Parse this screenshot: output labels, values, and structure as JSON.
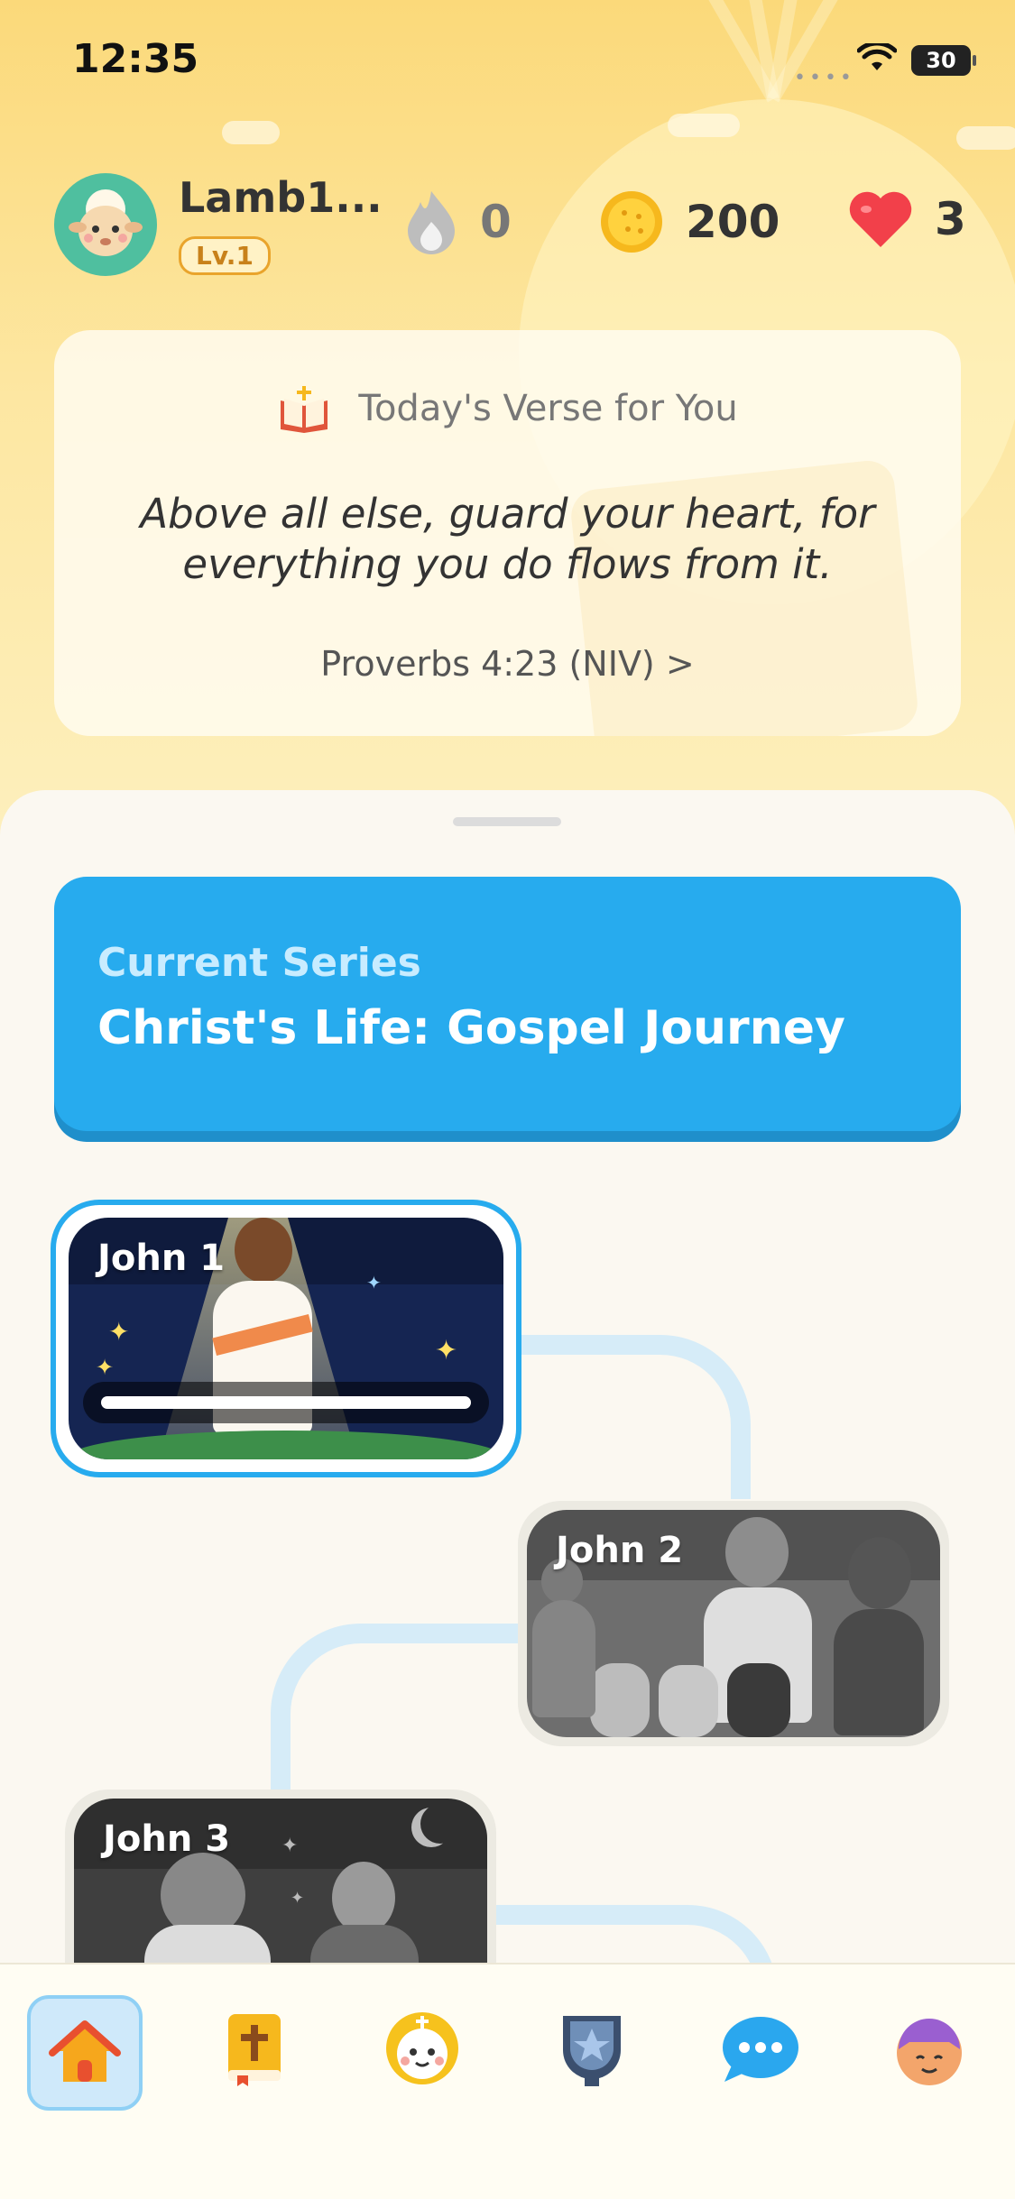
{
  "status_bar": {
    "time": "12:35",
    "battery": "30"
  },
  "header": {
    "username": "Lamb1...",
    "level": "Lv.1",
    "stats": {
      "streak": "0",
      "coins": "200",
      "hearts": "3"
    }
  },
  "verse": {
    "title": "Today's Verse for You",
    "text": "Above all else, guard your heart, for everything you do flows from it.",
    "reference": "Proverbs 4:23 (NIV) >"
  },
  "series": {
    "label": "Current Series",
    "title": "Christ's Life: Gospel Journey"
  },
  "chapters": [
    {
      "name": "John 1",
      "state": "current",
      "progress": 1.0
    },
    {
      "name": "John 2",
      "state": "locked"
    },
    {
      "name": "John 3",
      "state": "locked"
    }
  ],
  "nav": {
    "items": [
      "home-icon",
      "bible-icon",
      "lamb-icon",
      "badge-icon",
      "chat-icon",
      "profile-icon"
    ],
    "active": "home-icon"
  },
  "colors": {
    "accent": "#27abee",
    "path": "#d6ecf8",
    "sky": "#fbd97a"
  }
}
